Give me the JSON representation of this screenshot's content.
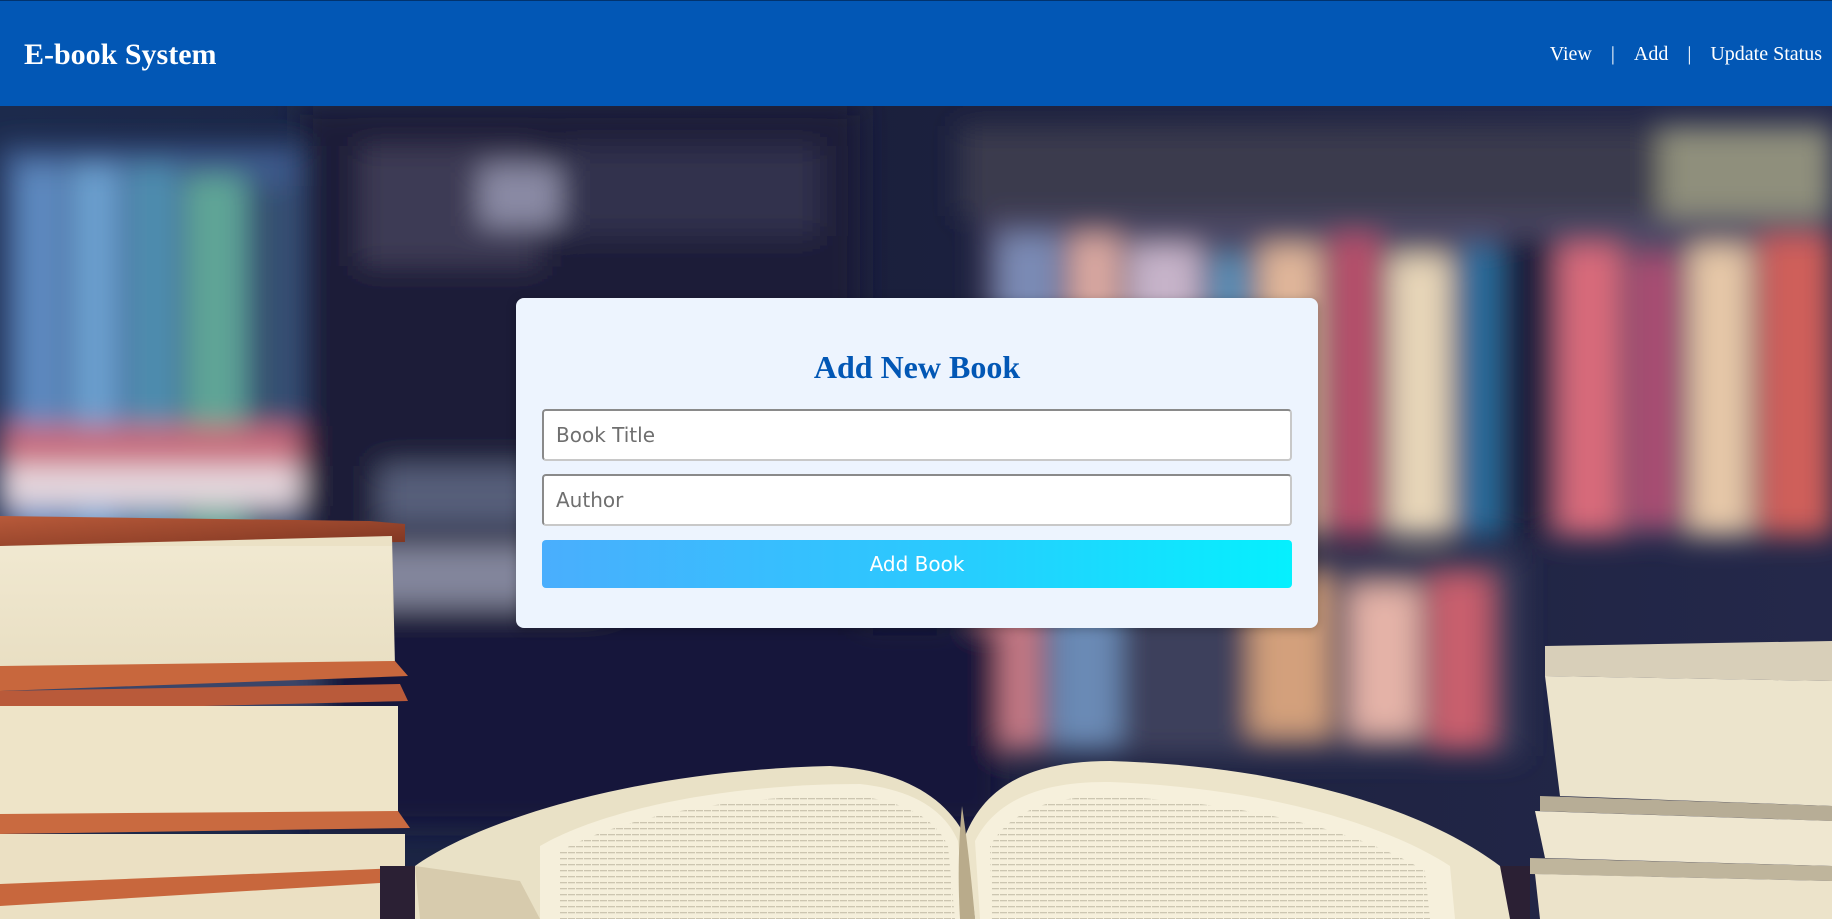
{
  "header": {
    "brand": "E-book System",
    "nav": {
      "view": "View",
      "separator": "|",
      "add": "Add",
      "update_status": "Update Status"
    },
    "background_color": "#0257b5"
  },
  "form": {
    "title": "Add New Book",
    "book_title_placeholder": "Book Title",
    "author_placeholder": "Author",
    "submit_label": "Add Book",
    "title_color": "#0257b5",
    "button_gradient": [
      "#4aaefd",
      "#05f0fe"
    ]
  },
  "background": {
    "image": "blurred-library-bookshelf-with-open-book"
  }
}
